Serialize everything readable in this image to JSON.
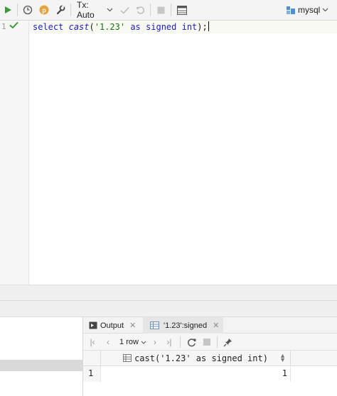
{
  "toolbar": {
    "tx_label": "Tx: Auto",
    "datasource": "mysql",
    "accent_run": "#3a9a3a",
    "accent_p": "#e8a33d"
  },
  "editor": {
    "line_number": "1",
    "code": {
      "kw_select": "select",
      "fn_cast": "cast",
      "open_paren": "(",
      "string": "'1.23'",
      "kw_as": "as",
      "kw_signed": "signed",
      "kw_int": "int",
      "close": ");"
    }
  },
  "results": {
    "tabs": [
      {
        "label": "Output"
      },
      {
        "label": "'1.23':signed"
      }
    ],
    "row_count": "1 row",
    "column_header": "cast('1.23' as signed int)",
    "rows": [
      {
        "num": "1",
        "value": "1"
      }
    ]
  }
}
